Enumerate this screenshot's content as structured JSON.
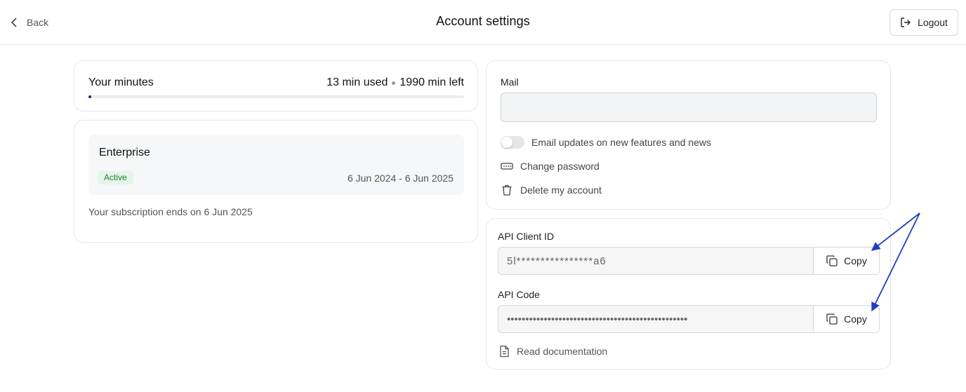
{
  "header": {
    "back_label": "Back",
    "title": "Account settings",
    "logout_label": "Logout"
  },
  "minutes": {
    "label": "Your minutes",
    "used": "13 min used",
    "left": "1990 min left",
    "progress_fraction": 0.0065
  },
  "plan": {
    "name": "Enterprise",
    "status": "Active",
    "dates": "6 Jun 2024 - 6 Jun 2025",
    "ends_text": "Your subscription ends on 6 Jun 2025"
  },
  "account": {
    "mail_label": "Mail",
    "mail_value": "",
    "email_updates_label": "Email updates on new features and news",
    "email_updates_on": false,
    "change_password_label": "Change password",
    "delete_account_label": "Delete my account"
  },
  "api": {
    "client_id_label": "API Client ID",
    "client_id_value": "5l****************a6",
    "code_label": "API Code",
    "code_value": "•••••••••••••••••••••••••••••••••••••••••••••••••",
    "copy_label": "Copy",
    "docs_label": "Read documentation"
  },
  "colors": {
    "progress_fill": "#1a237e",
    "badge_text": "#1e7b34",
    "badge_bg": "#e6f4ea",
    "annotation_arrow": "#1f3fbf"
  }
}
